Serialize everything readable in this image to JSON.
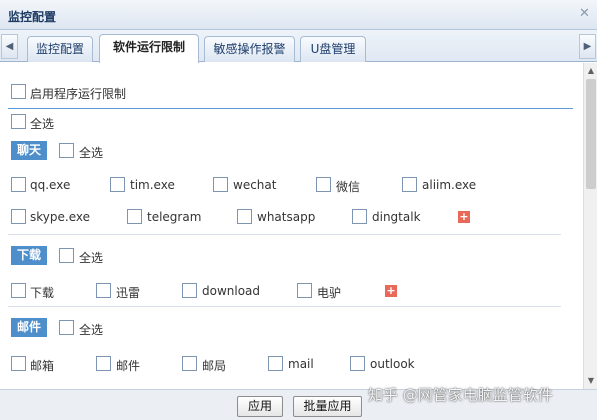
{
  "window": {
    "title": "监控配置",
    "close_glyph": "✕"
  },
  "tabs": [
    {
      "label": "监控配置",
      "active": false
    },
    {
      "label": "软件运行限制",
      "active": true
    },
    {
      "label": "敏感操作报警",
      "active": false
    },
    {
      "label": "U盘管理",
      "active": false
    }
  ],
  "tab_scroll": {
    "left_icon": "chevron-left-icon",
    "right_icon": "chevron-right-icon",
    "left_glyph": "◀",
    "right_glyph": "▶"
  },
  "restriction": {
    "enable_label": "启用程序运行限制",
    "enabled": false,
    "select_all_label": "全选"
  },
  "categories": [
    {
      "name": "聊天",
      "select_all_label": "全选",
      "items": [
        "qq.exe",
        "tim.exe",
        "wechat",
        "微信",
        "aliim.exe",
        "skype.exe",
        "telegram",
        "whatsapp",
        "dingtalk"
      ]
    },
    {
      "name": "下载",
      "select_all_label": "全选",
      "items": [
        "下载",
        "迅雷",
        "download",
        "电驴"
      ]
    },
    {
      "name": "邮件",
      "select_all_label": "全选",
      "items": [
        "邮箱",
        "邮件",
        "邮局",
        "mail",
        "outlook"
      ]
    }
  ],
  "add_glyph": "+",
  "scrollbar": {
    "up_glyph": "▲",
    "down_glyph": "▼"
  },
  "footer": {
    "apply_label": "应用",
    "batch_apply_label": "批量应用"
  },
  "watermark": "知乎 @网管家电脑监管软件",
  "colors": {
    "category_badge": "#4e8fcb",
    "add_button": "#e8685a",
    "divider": "#5a9bd5"
  }
}
